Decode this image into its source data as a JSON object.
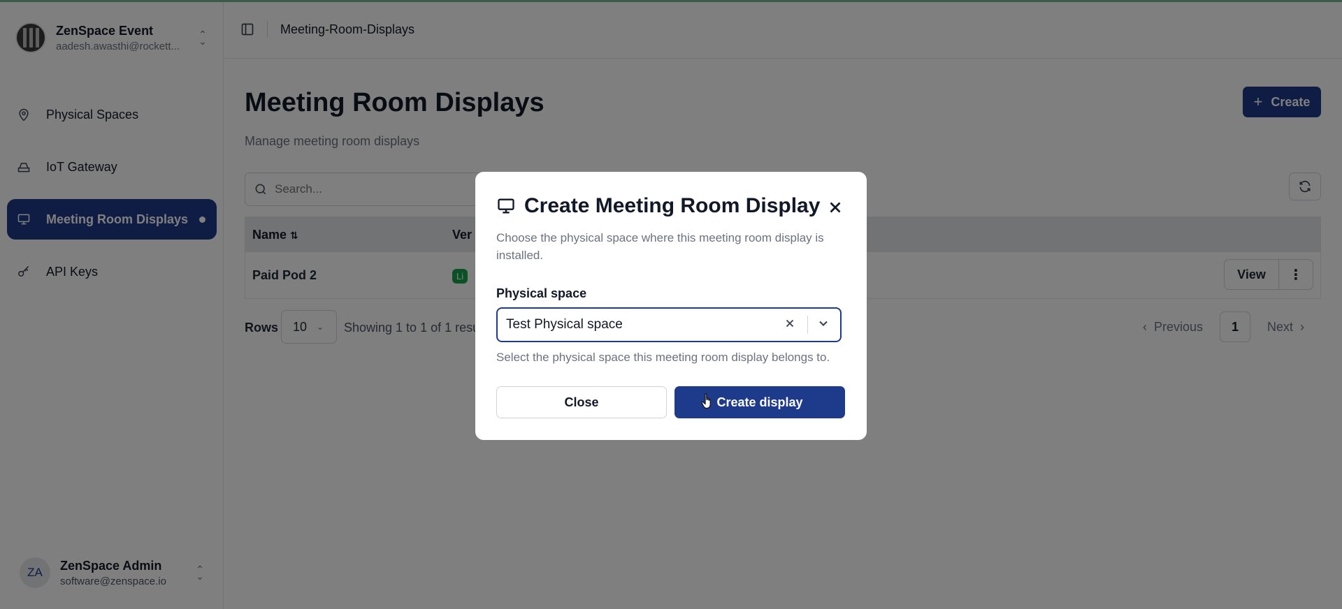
{
  "sidebar": {
    "org_name": "ZenSpace Event",
    "org_email": "aadesh.awasthi@rockett...",
    "items": [
      {
        "label": "Physical Spaces",
        "icon": "map-pin-icon"
      },
      {
        "label": "IoT Gateway",
        "icon": "router-icon"
      },
      {
        "label": "Meeting Room Displays",
        "icon": "monitor-icon",
        "active": true
      },
      {
        "label": "API Keys",
        "icon": "key-icon"
      }
    ],
    "user_initials": "ZA",
    "user_name": "ZenSpace Admin",
    "user_email": "software@zenspace.io"
  },
  "header": {
    "breadcrumb": "Meeting-Room-Displays"
  },
  "main": {
    "title": "Meeting Room Displays",
    "subtitle": "Manage meeting room displays",
    "create_label": "Create",
    "search_placeholder": "Search...",
    "columns": [
      "Name",
      "Ver"
    ],
    "rows": [
      {
        "name": "Paid Pod 2",
        "badge": "Li",
        "view_label": "View"
      }
    ],
    "rows_label": "Rows",
    "rows_value": "10",
    "showing_text": "Showing 1 to 1 of 1 resu",
    "prev_label": "Previous",
    "page": "1",
    "next_label": "Next"
  },
  "modal": {
    "title": "Create Meeting Room Display",
    "description": "Choose the physical space where this meeting room display is installed.",
    "field_label": "Physical space",
    "field_value": "Test Physical space",
    "field_help": "Select the physical space this meeting room display belongs to.",
    "close_label": "Close",
    "create_label": "Create display"
  },
  "colors": {
    "primary": "#1e3a8a",
    "badge_green": "#16a34a",
    "overlay": "rgba(0,0,0,0.5)"
  }
}
